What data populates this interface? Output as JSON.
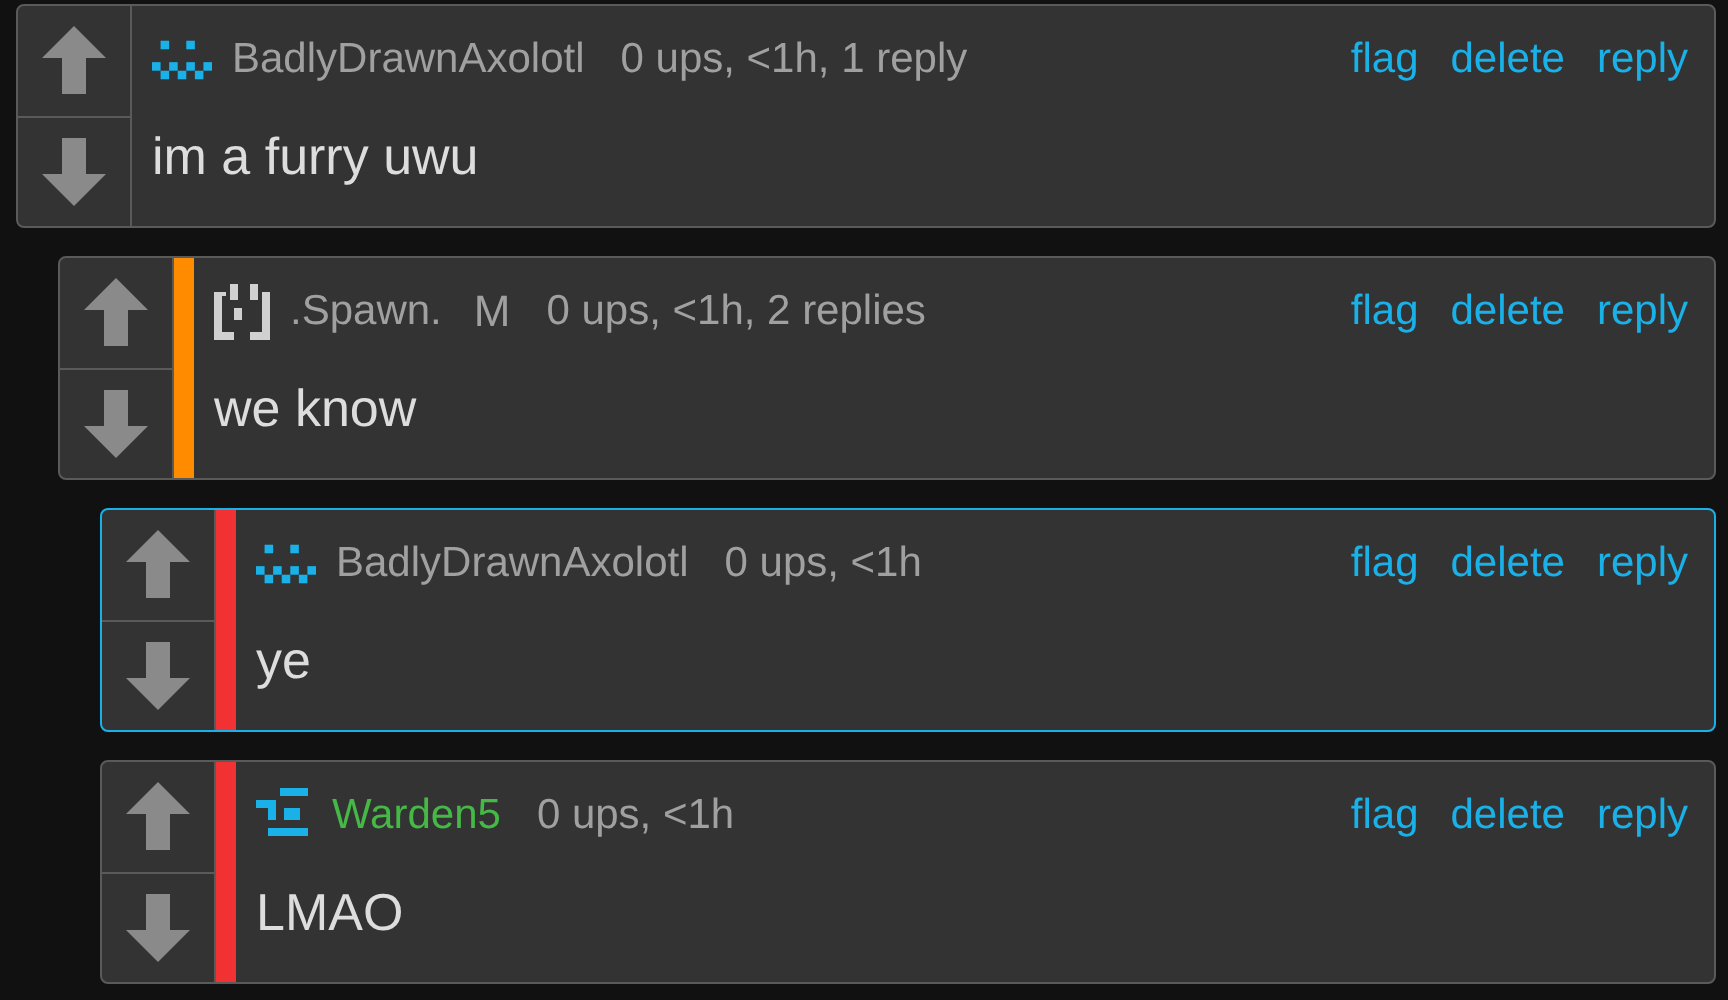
{
  "comments": [
    {
      "user": {
        "name": "BadlyDrawnAxolotl",
        "color": "#a0a0a0"
      },
      "meta": "0 ups, <1h, 1 reply",
      "actions": [
        "flag",
        "delete",
        "reply"
      ],
      "text": "im a furry uwu",
      "highlighted": false,
      "children": [
        {
          "user": {
            "name": ".Spawn.",
            "color": "#a0a0a0",
            "badge": "M"
          },
          "color": "#ff8c00",
          "meta": "0 ups, <1h, 2 replies",
          "actions": [
            "flag",
            "delete",
            "reply"
          ],
          "text": "we know",
          "highlighted": false,
          "children": [
            {
              "user": {
                "name": "BadlyDrawnAxolotl",
                "color": "#a0a0a0"
              },
              "color": "#f23232",
              "meta": "0 ups, <1h",
              "actions": [
                "flag",
                "delete",
                "reply"
              ],
              "text": "ye",
              "highlighted": true
            },
            {
              "user": {
                "name": "Warden5",
                "color": "#45b845"
              },
              "color": "#f23232",
              "meta": "0 ups, <1h",
              "actions": [
                "flag",
                "delete",
                "reply"
              ],
              "text": "LMAO",
              "highlighted": false
            }
          ]
        }
      ]
    }
  ]
}
